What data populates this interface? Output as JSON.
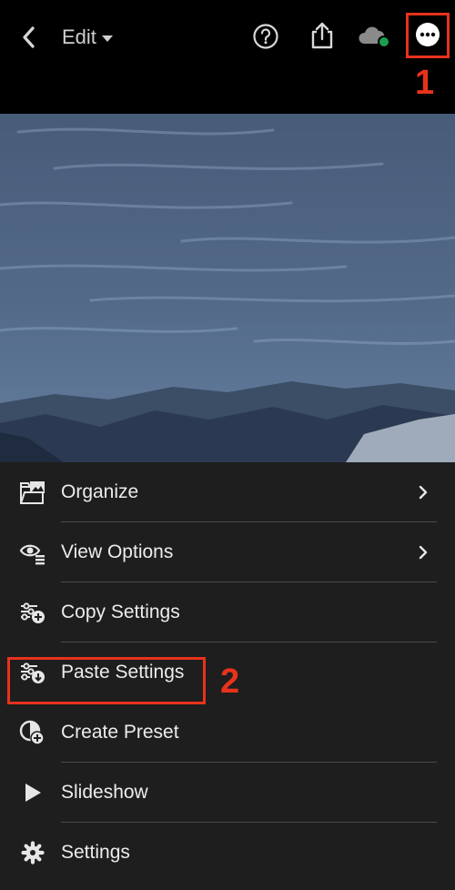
{
  "header": {
    "back_icon": "chevron-left-icon",
    "mode_label": "Edit",
    "icons": [
      "help-icon",
      "share-icon",
      "cloud-sync-icon",
      "more-options-icon"
    ],
    "sync_status_color": "#1c9e50"
  },
  "callouts": {
    "first": "1",
    "second": "2",
    "color": "#e8321c"
  },
  "menu": {
    "items": [
      {
        "label": "Organize",
        "icon": "organize-icon",
        "has_chevron": true
      },
      {
        "label": "View Options",
        "icon": "view-options-icon",
        "has_chevron": true
      },
      {
        "label": "Copy Settings",
        "icon": "copy-settings-icon",
        "has_chevron": false
      },
      {
        "label": "Paste Settings",
        "icon": "paste-settings-icon",
        "has_chevron": false
      },
      {
        "label": "Create Preset",
        "icon": "create-preset-icon",
        "has_chevron": false
      },
      {
        "label": "Slideshow",
        "icon": "play-icon",
        "has_chevron": false
      },
      {
        "label": "Settings",
        "icon": "gear-icon",
        "has_chevron": false
      }
    ]
  }
}
